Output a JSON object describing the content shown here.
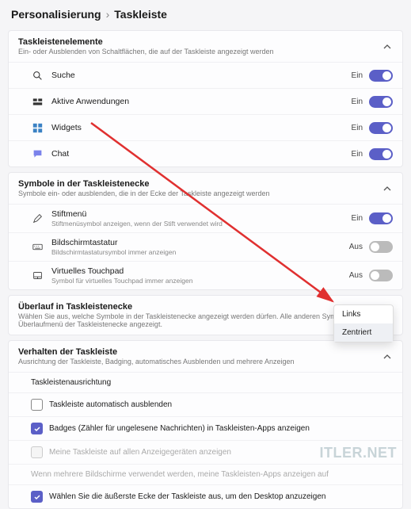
{
  "breadcrumb": {
    "parent": "Personalisierung",
    "current": "Taskleiste"
  },
  "sections": {
    "items": {
      "title": "Taskleistenelemente",
      "desc": "Ein- oder Ausblenden von Schaltflächen, die auf der Taskleiste angezeigt werden",
      "rows": [
        {
          "label": "Suche",
          "state": "Ein"
        },
        {
          "label": "Aktive Anwendungen",
          "state": "Ein"
        },
        {
          "label": "Widgets",
          "state": "Ein"
        },
        {
          "label": "Chat",
          "state": "Ein"
        }
      ]
    },
    "corner": {
      "title": "Symbole in der Taskleistenecke",
      "desc": "Symbole ein- oder ausblenden, die in der Ecke der Taskleiste angezeigt werden",
      "rows": [
        {
          "label": "Stiftmenü",
          "sublabel": "Stiftmenüsymbol anzeigen, wenn der Stift verwendet wird",
          "state": "Ein"
        },
        {
          "label": "Bildschirmtastatur",
          "sublabel": "Bildschirmtastatursymbol immer anzeigen",
          "state": "Aus"
        },
        {
          "label": "Virtuelles Touchpad",
          "sublabel": "Symbol für virtuelles Touchpad immer anzeigen",
          "state": "Aus"
        }
      ]
    },
    "overflow": {
      "title": "Überlauf in Taskleistenecke",
      "desc": "Wählen Sie aus, welche Symbole in der Taskleistenecke angezeigt werden dürfen. Alle anderen Symbole werden im Überlaufmenü der Taskleistenecke angezeigt."
    },
    "behavior": {
      "title": "Verhalten der Taskleiste",
      "desc": "Ausrichtung der Taskleiste, Badging, automatisches Ausblenden und mehrere Anzeigen",
      "alignment": "Taskleistenausrichtung",
      "options": {
        "left": "Links",
        "center": "Zentriert"
      },
      "settings": [
        "Taskleiste automatisch ausblenden",
        "Badges (Zähler für ungelesene Nachrichten) in Taskleisten-Apps anzeigen",
        "Meine Taskleiste auf allen Anzeigegeräten anzeigen",
        "Wenn mehrere Bildschirme verwendet werden, meine Taskleisten-Apps anzeigen auf",
        "Wählen Sie die äußerste Ecke der Taskleiste aus, um den Desktop anzuzeigen"
      ]
    }
  },
  "watermark": "ITLER.NET"
}
